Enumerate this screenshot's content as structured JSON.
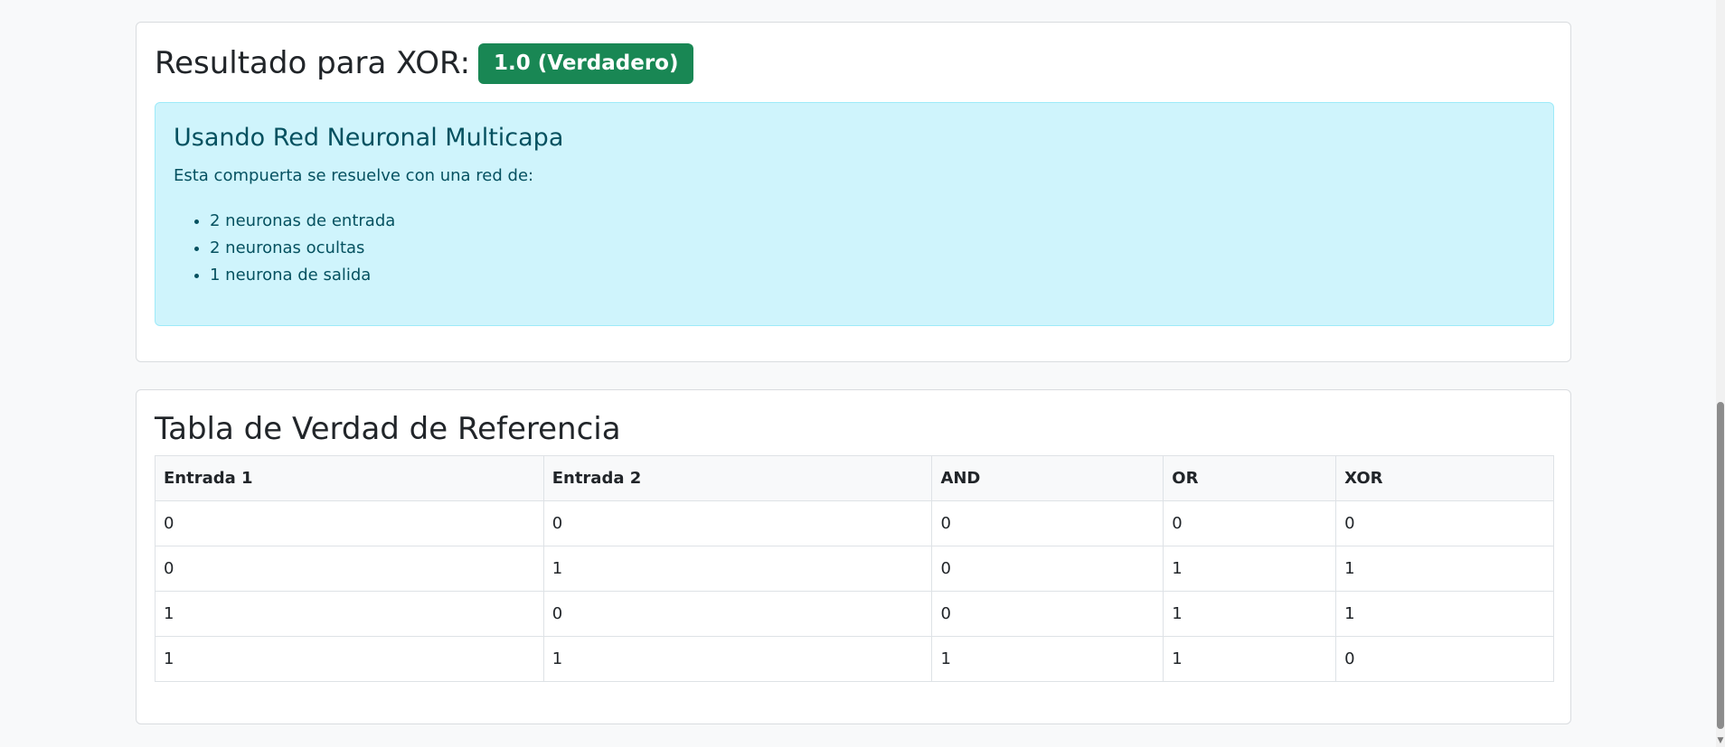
{
  "result": {
    "title": "Resultado para XOR:",
    "badge": "1.0 (Verdadero)",
    "badge_color": "#198754"
  },
  "info": {
    "heading": "Usando Red Neuronal Multicapa",
    "text": "Esta compuerta se resuelve con una red de:",
    "items": [
      "2 neuronas de entrada",
      "2 neuronas ocultas",
      "1 neurona de salida"
    ],
    "bg_color": "#cff4fc",
    "text_color": "#055160"
  },
  "truth_table": {
    "title": "Tabla de Verdad de Referencia",
    "headers": [
      "Entrada 1",
      "Entrada 2",
      "AND",
      "OR",
      "XOR"
    ],
    "rows": [
      [
        "0",
        "0",
        "0",
        "0",
        "0"
      ],
      [
        "0",
        "1",
        "0",
        "1",
        "1"
      ],
      [
        "1",
        "0",
        "0",
        "1",
        "1"
      ],
      [
        "1",
        "1",
        "1",
        "1",
        "0"
      ]
    ]
  },
  "scrollbar": {
    "arrow_icon": "scroll-down-arrow-icon"
  }
}
